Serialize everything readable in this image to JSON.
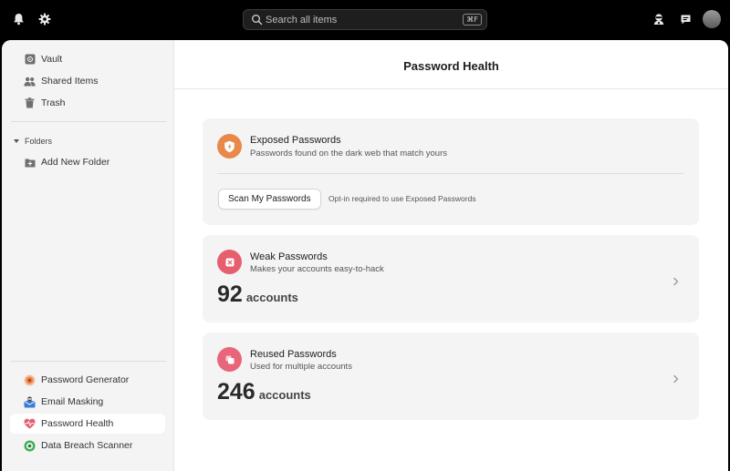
{
  "topbar": {
    "icons": [
      "bell-icon",
      "gear-icon",
      "mask-user-icon",
      "chat-icon"
    ],
    "search": {
      "placeholder": "Search all items",
      "shortcut": "⌘F"
    }
  },
  "sidebar": {
    "top_items": [
      {
        "label": "Vault",
        "icon": "vault-icon"
      },
      {
        "label": "Shared Items",
        "icon": "people-icon"
      },
      {
        "label": "Trash",
        "icon": "trash-icon"
      }
    ],
    "folders_label": "Folders",
    "add_folder_label": "Add New Folder",
    "tools": [
      {
        "label": "Password Generator",
        "icon": "password-generator-icon"
      },
      {
        "label": "Email Masking",
        "icon": "email-mask-icon"
      },
      {
        "label": "Password Health",
        "icon": "heart-pulse-icon",
        "active": true
      },
      {
        "label": "Data Breach Scanner",
        "icon": "breach-scanner-icon"
      }
    ]
  },
  "main": {
    "title": "Password Health",
    "exposed": {
      "title": "Exposed Passwords",
      "subtitle": "Passwords found on the dark web that match yours",
      "button": "Scan My Passwords",
      "note": "Opt-in required to use Exposed Passwords",
      "color": "#e8894a"
    },
    "weak": {
      "title": "Weak Passwords",
      "subtitle": "Makes your accounts easy-to-hack",
      "count": "92",
      "unit": "accounts",
      "color": "#e65f6e"
    },
    "reused": {
      "title": "Reused Passwords",
      "subtitle": "Used for multiple accounts",
      "count": "246",
      "unit": "accounts",
      "color": "#e8667a"
    }
  }
}
